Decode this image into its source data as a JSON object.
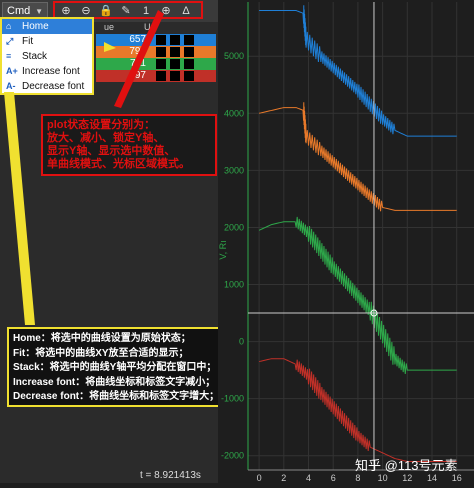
{
  "toolbar": {
    "cmd_label": "Cmd",
    "buttons": [
      {
        "icon": "zoom-in-icon",
        "glyph": "⊕"
      },
      {
        "icon": "zoom-out-icon",
        "glyph": "⊖"
      },
      {
        "icon": "lock-icon",
        "glyph": "🔒"
      },
      {
        "icon": "pen-icon",
        "glyph": "✎"
      },
      {
        "icon": "one-icon",
        "glyph": "1"
      },
      {
        "icon": "plus-circle-icon",
        "glyph": "⊕"
      },
      {
        "icon": "delta-icon",
        "glyph": "Δ"
      }
    ]
  },
  "table": {
    "headers": [
      "ue",
      "Un"
    ],
    "rows": [
      {
        "value": "657",
        "color": "#1f7fd6"
      },
      {
        "value": "792",
        "color": "#e8792a"
      },
      {
        "value": "711",
        "color": "#2ea84a"
      },
      {
        "value": "697",
        "color": "#c03028"
      }
    ]
  },
  "menu": {
    "items": [
      {
        "icon": "home-icon",
        "glyph": "⌂",
        "label": "Home",
        "selected": true
      },
      {
        "icon": "fit-icon",
        "glyph": "⤢",
        "label": "Fit",
        "selected": false
      },
      {
        "icon": "stack-icon",
        "glyph": "≡",
        "label": "Stack",
        "selected": false
      },
      {
        "icon": "increase-font-icon",
        "glyph": "A+",
        "label": "Increase font",
        "selected": false
      },
      {
        "icon": "decrease-font-icon",
        "glyph": "A-",
        "label": "Decrease font",
        "selected": false
      }
    ]
  },
  "annotation_red": {
    "lines": [
      "plot状态设置分别为：",
      "放大、减小、锁定Y轴、",
      "显示Y轴、显示选中数值、",
      "单曲线模式、光标区域模式。"
    ]
  },
  "annotation_yellow": {
    "lines": [
      "Home：将选中的曲线设置为原始状态；",
      "Fit：将选中的曲线XY放至合适的显示；",
      "Stack：将选中的曲线Y轴平均分配在窗口中；",
      "Increase font：将曲线坐标和标签文字减小；",
      "Decrease font：将曲线坐标和标签文字增大；"
    ]
  },
  "time_label": "t = 8.921413s",
  "watermark": "知乎 @113号元素",
  "colors": {
    "blue": "#1f7fd6",
    "orange": "#e8792a",
    "green": "#2ea84a",
    "red": "#c03028",
    "axis": "#2ea84a"
  },
  "chart_data": {
    "type": "line",
    "y_axis_label": "V, Rı",
    "y_ticks": [
      -2000,
      -1000,
      0,
      1000,
      2000,
      3000,
      4000,
      5000
    ],
    "x_ticks": [
      0,
      2,
      4,
      6,
      8,
      10,
      12,
      14,
      16
    ],
    "ylim": [
      -2250,
      5950
    ],
    "xlim": [
      -0.9,
      17.4
    ],
    "cursor": {
      "x": 9.3,
      "y": 500
    },
    "series": [
      {
        "color": "#1f7fd6",
        "x": [
          0,
          1,
          2,
          3,
          3.6,
          3.8,
          5,
          6,
          7,
          8,
          9,
          10,
          11,
          12,
          14,
          16
        ],
        "y": [
          5800,
          5800,
          5800,
          5800,
          5750,
          5300,
          5000,
          4800,
          4600,
          4400,
          4150,
          3900,
          3700,
          3600,
          3600,
          3600
        ]
      },
      {
        "color": "#e8792a",
        "x": [
          0,
          1,
          2,
          3,
          3.6,
          3.8,
          5,
          6,
          7,
          8,
          9,
          10,
          11,
          12,
          14,
          16
        ],
        "y": [
          4000,
          4050,
          4100,
          4100,
          4050,
          3600,
          3350,
          3150,
          2950,
          2750,
          2550,
          2350,
          2300,
          2300,
          2300,
          2300
        ]
      },
      {
        "color": "#2ea84a",
        "x": [
          0,
          1,
          2,
          3,
          4,
          5,
          6,
          7,
          8,
          9,
          10,
          11,
          12,
          14,
          16
        ],
        "y": [
          1950,
          2050,
          2100,
          2100,
          1900,
          1600,
          1300,
          1050,
          800,
          550,
          150,
          -300,
          -500,
          -500,
          -500
        ]
      },
      {
        "color": "#c03028",
        "x": [
          0,
          1,
          2,
          3,
          4,
          5,
          6,
          7,
          8,
          9,
          10,
          11,
          12,
          14,
          16
        ],
        "y": [
          -350,
          -300,
          -300,
          -400,
          -600,
          -900,
          -1150,
          -1400,
          -1650,
          -1850,
          -1950,
          -2050,
          -2100,
          -2100,
          -2100
        ]
      }
    ]
  }
}
